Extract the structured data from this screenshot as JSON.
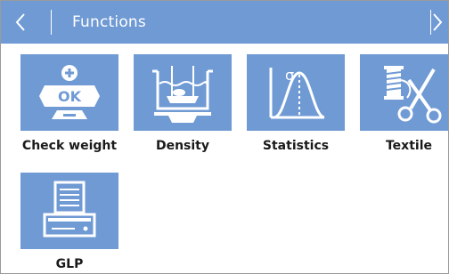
{
  "header": {
    "title": "Functions"
  },
  "colors": {
    "header_bg": "#6f9ad4",
    "tile_bg": "#6f9ad4",
    "icon_fg": "#ffffff",
    "label_text": "#1a1a1a"
  },
  "functions": [
    {
      "label": "Check weight",
      "icon": "check-weight-icon"
    },
    {
      "label": "Density",
      "icon": "density-icon"
    },
    {
      "label": "Statistics",
      "icon": "statistics-icon"
    },
    {
      "label": "Textile",
      "icon": "textile-icon"
    },
    {
      "label": "GLP",
      "icon": "glp-printer-icon"
    }
  ],
  "check_weight_icon_text": "OK"
}
